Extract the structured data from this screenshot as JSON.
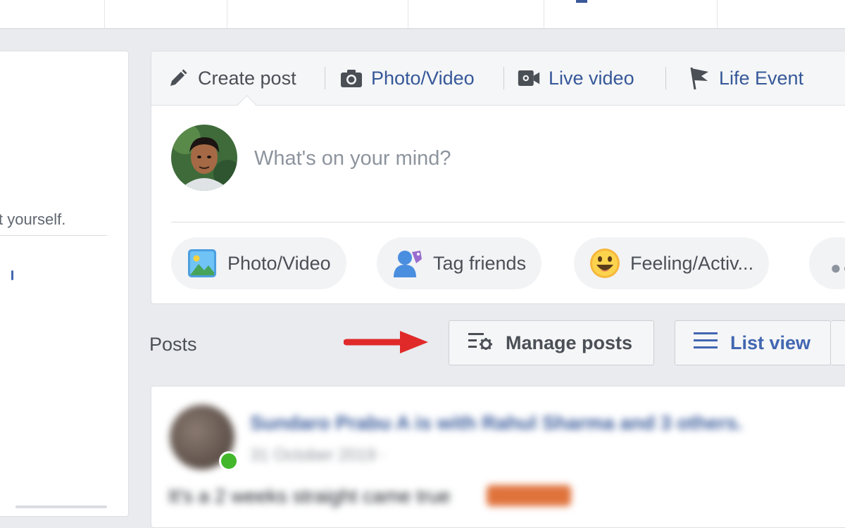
{
  "composer": {
    "tabs": [
      {
        "label": "Create post",
        "icon": "pencil-icon"
      },
      {
        "label": "Photo/Video",
        "icon": "camera-icon"
      },
      {
        "label": "Live video",
        "icon": "video-camera-icon"
      },
      {
        "label": "Life Event",
        "icon": "flag-icon"
      }
    ],
    "placeholder": "What's on your mind?",
    "actions": [
      {
        "label": "Photo/Video",
        "icon": "photo-icon"
      },
      {
        "label": "Tag friends",
        "icon": "tag-friends-icon"
      },
      {
        "label": "Feeling/Activ...",
        "icon": "smiley-icon"
      }
    ],
    "more_icon": "more-dots-icon"
  },
  "left_column": {
    "intro_text": "t yourself."
  },
  "posts_bar": {
    "title": "Posts",
    "manage_label": "Manage posts",
    "list_view_label": "List view"
  },
  "feed_post": {
    "author": "Sundaro Prabu A is with Rahul Sharma and 3 others.",
    "time": "31 October 2019 · ",
    "text": "It's a 2 weeks straight came true "
  },
  "colors": {
    "background": "#e9ebee",
    "link_blue": "#365899",
    "brand_blue": "#4267b2",
    "text_grey": "#4b4f56",
    "arrow_red": "#e02a2a"
  }
}
